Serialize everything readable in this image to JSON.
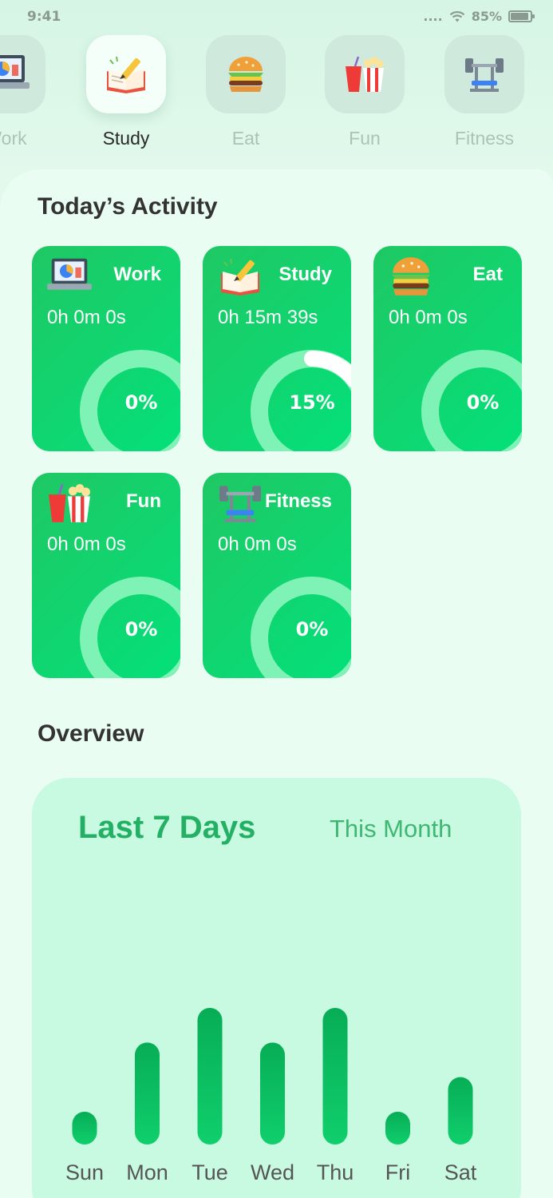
{
  "status": {
    "time": "9:41",
    "signal": "....",
    "battery": "85%",
    "battery_level": 0.85
  },
  "categories": [
    {
      "label": "Work",
      "icon": "laptop-chart-icon"
    },
    {
      "label": "Study",
      "icon": "book-pencil-icon",
      "active": true
    },
    {
      "label": "Eat",
      "icon": "burger-icon"
    },
    {
      "label": "Fun",
      "icon": "popcorn-drink-icon"
    },
    {
      "label": "Fitness",
      "icon": "barbell-bench-icon"
    }
  ],
  "activity": {
    "title": "Today’s Activity",
    "cards": [
      {
        "name": "Work",
        "time": "0h 0m 0s",
        "percent": "0%",
        "progress": 0,
        "icon": "laptop-chart-icon"
      },
      {
        "name": "Study",
        "time": "0h 15m 39s",
        "percent": "15%",
        "progress": 0.15,
        "icon": "book-pencil-icon"
      },
      {
        "name": "Eat",
        "time": "0h 0m 0s",
        "percent": "0%",
        "progress": 0,
        "icon": "burger-icon"
      },
      {
        "name": "Fun",
        "time": "0h 0m 0s",
        "percent": "0%",
        "progress": 0,
        "icon": "popcorn-drink-icon"
      },
      {
        "name": "Fitness",
        "time": "0h 0m 0s",
        "percent": "0%",
        "progress": 0,
        "icon": "barbell-bench-icon"
      }
    ]
  },
  "overview": {
    "title": "Overview",
    "tabs": {
      "week": "Last 7 Days",
      "month": "This Month"
    },
    "active_tab": "week"
  },
  "chart_data": {
    "type": "bar",
    "categories": [
      "Sun",
      "Mon",
      "Tue",
      "Wed",
      "Thu",
      "Fri",
      "Sat"
    ],
    "values": [
      1,
      4,
      5.5,
      4,
      5.5,
      1,
      2.5
    ],
    "ylim": [
      0,
      5.5
    ],
    "grid": false,
    "color": "#0dbf63"
  },
  "colors": {
    "card_green": "#1fc864",
    "ring_track": "#7ff2b5",
    "accent": "#23b064"
  }
}
